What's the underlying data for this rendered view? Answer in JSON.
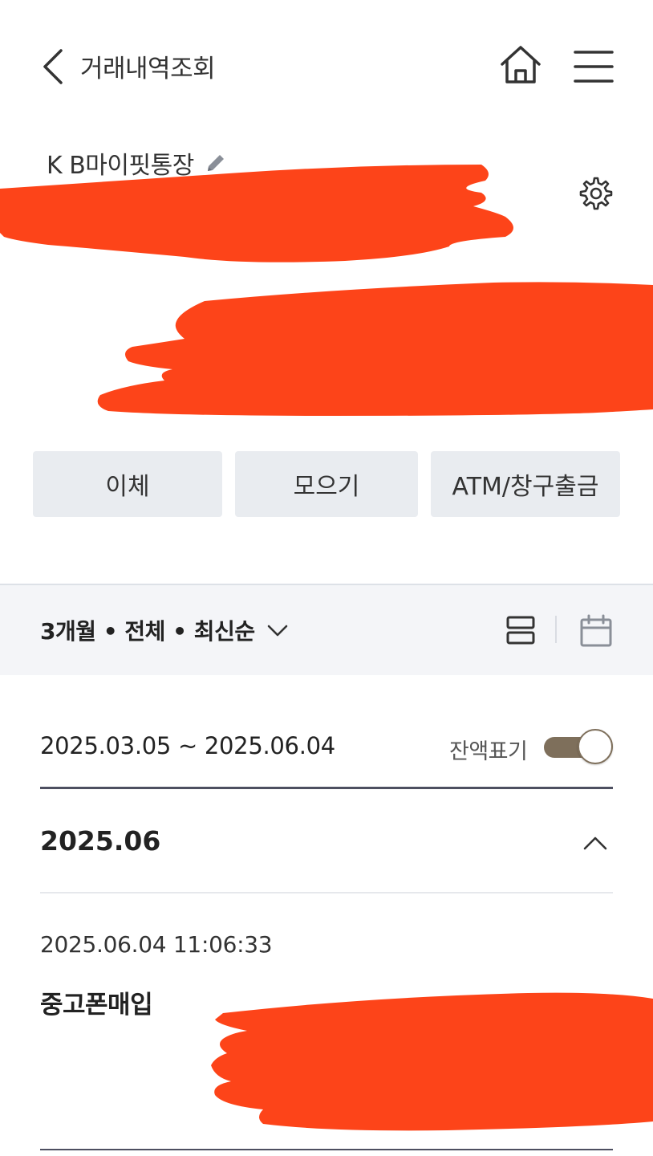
{
  "header": {
    "title": "거래내역조회",
    "back_icon": "chevron-left-icon",
    "home_icon": "home-icon",
    "menu_icon": "hamburger-menu-icon"
  },
  "account": {
    "name": "K B마이핏통장",
    "edit_icon": "pencil-icon",
    "settings_icon": "gear-icon"
  },
  "actions": [
    {
      "label": "이체"
    },
    {
      "label": "모으기"
    },
    {
      "label": "ATM/창구출금"
    }
  ],
  "filter": {
    "summary": "3개월 • 전체 • 최신순",
    "list_view_icon": "list-view-icon",
    "calendar_icon": "calendar-icon"
  },
  "range": {
    "text": "2025.03.05 ~ 2025.06.04",
    "balance_label": "잔액표기",
    "balance_toggle_on": true
  },
  "month": {
    "label": "2025.06",
    "collapse_icon": "chevron-up-icon"
  },
  "transactions": [
    {
      "datetime": "2025.06.04 11:06:33",
      "name": "중고폰매입"
    }
  ],
  "colors": {
    "redaction": "#fd4419",
    "toggle_on": "#7e6f5b",
    "button_bg": "#e9ecf0",
    "filter_bg": "#f4f5f8"
  }
}
